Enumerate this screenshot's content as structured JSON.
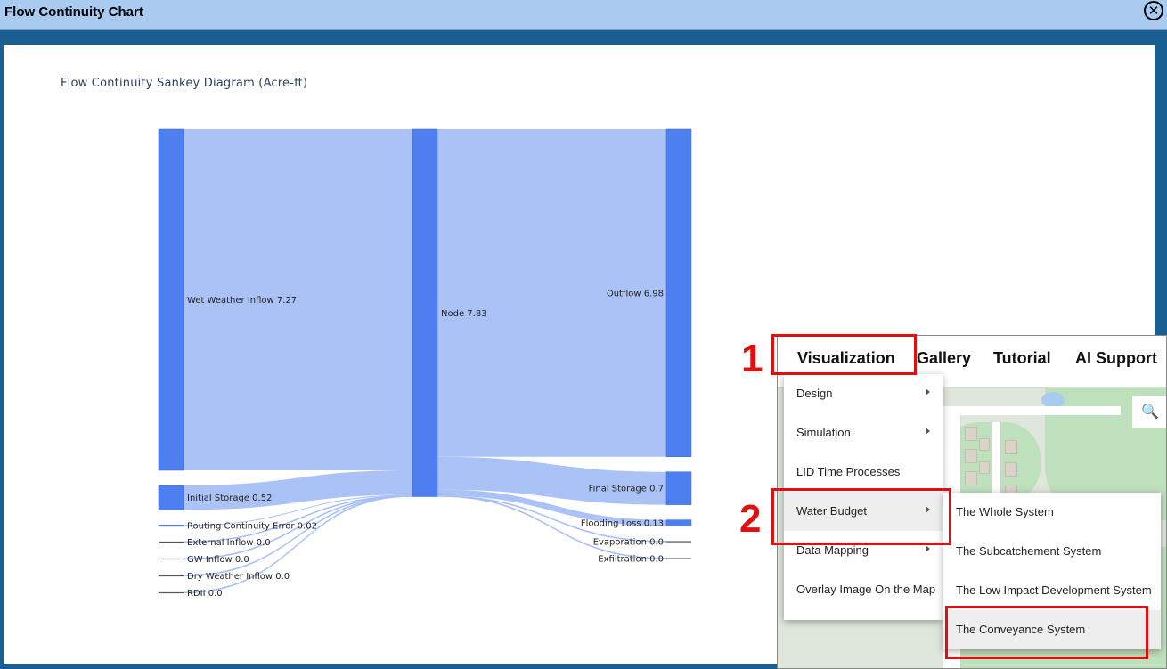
{
  "window": {
    "title": "Flow Continuity Chart",
    "close_icon": "close-circle-icon"
  },
  "chart_data": {
    "type": "sankey",
    "title": "Flow Continuity Sankey Diagram (Acre-ft)",
    "nodes": [
      {
        "id": "wwi",
        "label": "Wet Weather Inflow 7.27",
        "value": 7.27,
        "column": 0
      },
      {
        "id": "is",
        "label": "Initial Storage 0.52",
        "value": 0.52,
        "column": 0
      },
      {
        "id": "rce",
        "label": "Routing Continuity Error 0.02",
        "value": 0.02,
        "column": 0
      },
      {
        "id": "ei",
        "label": "External Inflow 0.0",
        "value": 0.0,
        "column": 0
      },
      {
        "id": "gw",
        "label": "GW Inflow 0.0",
        "value": 0.0,
        "column": 0
      },
      {
        "id": "dwi",
        "label": "Dry Weather Inflow 0.0",
        "value": 0.0,
        "column": 0
      },
      {
        "id": "rdii",
        "label": "RDII 0.0",
        "value": 0.0,
        "column": 0
      },
      {
        "id": "node",
        "label": "Node 7.83",
        "value": 7.83,
        "column": 1
      },
      {
        "id": "out",
        "label": "Outflow 6.98",
        "value": 6.98,
        "column": 2
      },
      {
        "id": "fs",
        "label": "Final Storage 0.7",
        "value": 0.7,
        "column": 2
      },
      {
        "id": "fl",
        "label": "Flooding Loss 0.13",
        "value": 0.13,
        "column": 2
      },
      {
        "id": "ev",
        "label": "Evaporation 0.0",
        "value": 0.0,
        "column": 2
      },
      {
        "id": "ex",
        "label": "Exfiltration 0.0",
        "value": 0.0,
        "column": 2
      }
    ],
    "links": [
      {
        "source": "wwi",
        "target": "node",
        "value": 7.27
      },
      {
        "source": "is",
        "target": "node",
        "value": 0.52
      },
      {
        "source": "rce",
        "target": "node",
        "value": 0.02
      },
      {
        "source": "ei",
        "target": "node",
        "value": 0.0
      },
      {
        "source": "gw",
        "target": "node",
        "value": 0.0
      },
      {
        "source": "dwi",
        "target": "node",
        "value": 0.0
      },
      {
        "source": "rdii",
        "target": "node",
        "value": 0.0
      },
      {
        "source": "node",
        "target": "out",
        "value": 6.98
      },
      {
        "source": "node",
        "target": "fs",
        "value": 0.7
      },
      {
        "source": "node",
        "target": "fl",
        "value": 0.13
      },
      {
        "source": "node",
        "target": "ev",
        "value": 0.0
      },
      {
        "source": "node",
        "target": "ex",
        "value": 0.0
      }
    ],
    "colors": {
      "node": "#4e7ff0",
      "link": "#a6bff5",
      "zero": "#555555"
    }
  },
  "menu": {
    "nav": [
      "Visualization",
      "Gallery",
      "Tutorial",
      "AI Support"
    ],
    "dropdown": [
      {
        "label": "Design",
        "submenu": true
      },
      {
        "label": "Simulation",
        "submenu": true
      },
      {
        "label": "LID Time Processes",
        "submenu": false
      },
      {
        "label": "Water Budget",
        "submenu": true
      },
      {
        "label": "Data Mapping",
        "submenu": true
      },
      {
        "label": "Overlay Image On the Map",
        "submenu": false
      }
    ],
    "submenu": [
      "The Whole System",
      "The Subcatchement System",
      "The Low Impact Development System",
      "The Conveyance System"
    ],
    "steps": [
      "1",
      "2"
    ],
    "map_search_icon": "magnifier-icon",
    "highlight_color": "#e01010"
  }
}
